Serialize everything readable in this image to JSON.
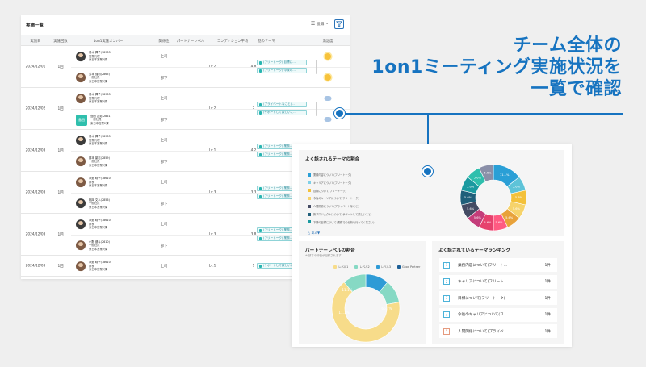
{
  "table": {
    "title": "実施一覧",
    "sort_label": "役職",
    "columns": [
      "実施日",
      "実施回数",
      "1on1実施メンバー",
      "関係性",
      "パートナーレベル",
      "コンディション平均",
      "話のテーマ",
      "満足度"
    ],
    "rows": [
      {
        "date": "2024/12/01",
        "count": "1回",
        "level": "Lv.2",
        "condition": "4.8",
        "members": [
          {
            "role": "上司",
            "lines": [
              "青木 輝子(18935)",
              "営業代理",
              "東日本営業2課"
            ],
            "tag": "",
            "mood": "sun"
          },
          {
            "role": "部下",
            "lines": [
              "芳本 強司(2865)",
              "一般社員",
              "東日本営業2課"
            ],
            "tag": "",
            "mood": "sun"
          }
        ],
        "tags": [
          "(フリートーク) 目標に…",
          "(フリートーク) 今後の…"
        ]
      },
      {
        "date": "2024/12/02",
        "count": "1回",
        "level": "Lv.2",
        "condition": "2",
        "members": [
          {
            "role": "上司",
            "lines": [
              "青木 輝子(18935)",
              "営業代理",
              "東日本営業2課"
            ],
            "mood": "cloud"
          },
          {
            "role": "部下",
            "lines": [
              "島田 吉男(2861)",
              "一般社員",
              "東日本営業2課"
            ],
            "mood": "cloud",
            "initial": "島田"
          }
        ],
        "tags": [
          "(プライベートなこと)…",
          "(サポートして欲しいこ…"
        ]
      },
      {
        "date": "2024/12/03",
        "count": "1回",
        "level": "Lv.1",
        "condition": "4.2",
        "members": [
          {
            "role": "上司",
            "lines": [
              "青木 輝子(18935)",
              "営業代理",
              "東日本営業2課"
            ]
          },
          {
            "role": "部下",
            "lines": [
              "藤本 豪志(2859)",
              "一般社員",
              "東日本営業2課"
            ]
          }
        ],
        "tags": [
          "(フリートーク) 業務…",
          "(フリートーク) 業務…"
        ]
      },
      {
        "date": "2024/12/03",
        "count": "1回",
        "level": "Lv.3",
        "condition": "3.3",
        "members": [
          {
            "role": "上司",
            "lines": [
              "永野 晴子(18610)",
              "部長",
              "東日本営業2課"
            ]
          },
          {
            "role": "部下",
            "lines": [
              "桃岡 文人(2856)",
              "一般社員",
              "東日本営業2課"
            ]
          }
        ],
        "tags": [
          "(フリートーク) 業務…",
          "(フリートーク) 業務…"
        ]
      },
      {
        "date": "2024/12/03",
        "count": "1回",
        "level": "Lv.3",
        "condition": "3.8",
        "members": [
          {
            "role": "上司",
            "lines": [
              "永野 晴子(18610)",
              "部長",
              "東日本営業2課"
            ]
          },
          {
            "role": "部下",
            "lines": [
              "小野 健斗(2610)",
              "一般社員",
              "東日本営業2課"
            ]
          }
        ],
        "tags": [
          "(フリートーク) 業務…",
          "(フリートーク) 業務…"
        ]
      },
      {
        "date": "2024/12/03",
        "count": "1回",
        "level": "Lv.1",
        "condition": "1",
        "members": [
          {
            "role": "上司",
            "lines": [
              "永野 晴子(18610)",
              "部長",
              "東日本営業2課"
            ]
          }
        ],
        "tags": [
          "(サポートして欲しいこ…"
        ]
      }
    ]
  },
  "headline": {
    "line1": "チーム全体の",
    "line2": "1on1ミーティング実施状況を",
    "line3": "一覧で確認"
  },
  "theme_panel": {
    "title": "よく話されるテーマの割合",
    "legend": [
      {
        "label": "業務内容について(フリートーク)",
        "color": "#2a9fd6"
      },
      {
        "label": "キャリアについて(フリートーク)",
        "color": "#7fd0e8"
      },
      {
        "label": "目標について(フリートーク)",
        "color": "#f3c13a"
      },
      {
        "label": "今後のキャリアについて(フリートーク)",
        "color": "#f6d36b"
      },
      {
        "label": "人間関係について(プライベートなこと)",
        "color": "#444b63"
      },
      {
        "label": "新プロジェクトについて(サポートして欲しいこと)",
        "color": "#1f5f7a"
      },
      {
        "label": "下期の目標について(業務での分析を行ってください)",
        "color": "#1a9aa0"
      }
    ],
    "pager": "△ 1/3 ▼",
    "donut_labels": [
      "11.1%",
      "5.6%",
      "5.6%",
      "5.6%",
      "5.6%",
      "5.6%",
      "5.6%",
      "5.6%",
      "5.6%",
      "5.6%",
      "5.6%",
      "5.6%",
      "5.6%"
    ]
  },
  "partner_panel": {
    "title": "パートナーレベルの割合",
    "subtitle": "※ 部下の評価が記録されます",
    "legend": [
      {
        "label": "レベル1",
        "color": "#f7dc8a"
      },
      {
        "label": "レベル2",
        "color": "#86d9c4"
      },
      {
        "label": "レベル3",
        "color": "#2e9bd6"
      },
      {
        "label": "Good Partner",
        "color": "#1d5f96"
      }
    ],
    "labels": [
      "11.1%",
      "11.1%",
      "66.7%"
    ]
  },
  "ranking_panel": {
    "title": "よく話されているテーマランキング",
    "items": [
      {
        "rank": "1",
        "label": "業務内容について(フリート…",
        "count": "1件",
        "color": "#4db3d9"
      },
      {
        "rank": "2",
        "label": "キャリアについて(フリート…",
        "count": "1件",
        "color": "#4db3d9"
      },
      {
        "rank": "3",
        "label": "目標について(フリートーク)",
        "count": "1件",
        "color": "#4db3d9"
      },
      {
        "rank": "4",
        "label": "今後のキャリアについて(フ…",
        "count": "1件",
        "color": "#4db3d9"
      },
      {
        "rank": "5",
        "label": "人間関係について(プライベ…",
        "count": "1件",
        "color": "#e59a7e"
      }
    ]
  },
  "colors": {
    "accent": "#1673c0",
    "teal": "#27b5b0"
  }
}
